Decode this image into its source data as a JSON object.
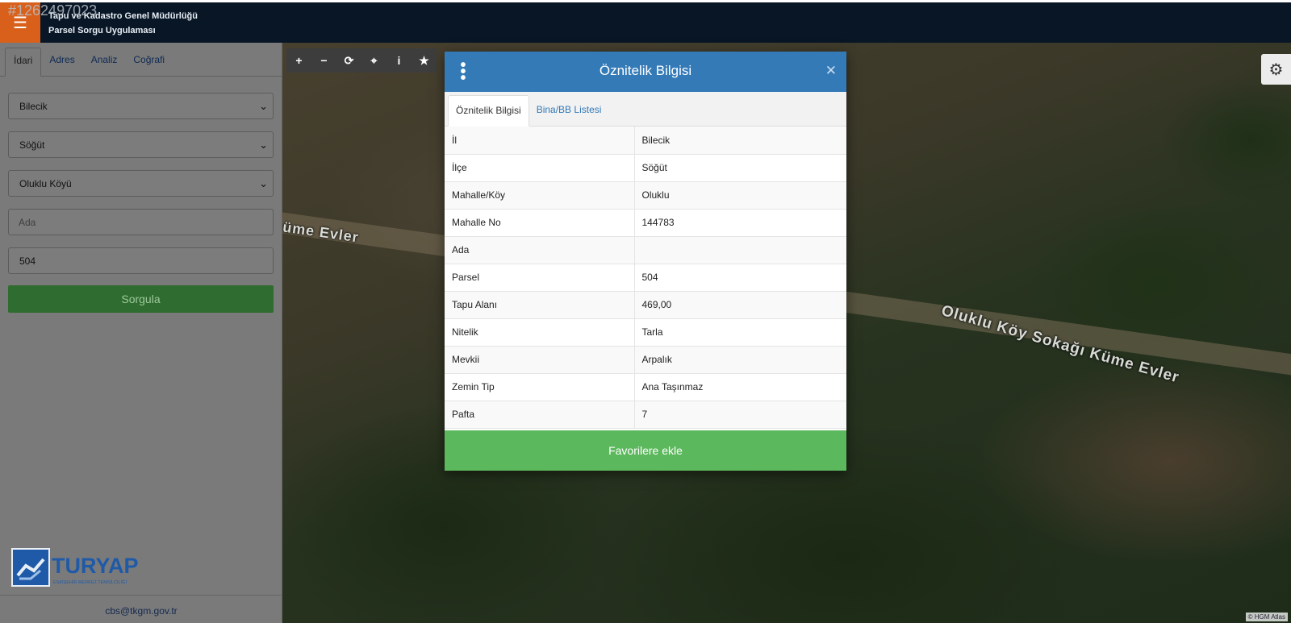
{
  "header": {
    "watermark_id": "#1262497023",
    "title_line1": "Tapu ve Kadastro Genel Müdürlüğü",
    "title_line2": "Parsel Sorgu Uygulaması",
    "menu_icon": "hamburger-icon",
    "accent_color": "#d9601a",
    "bar_color": "#081626"
  },
  "sidebar": {
    "tabs": [
      {
        "label": "İdari",
        "active": true
      },
      {
        "label": "Adres"
      },
      {
        "label": "Analiz"
      },
      {
        "label": "Coğrafi"
      }
    ],
    "il": "Bilecik",
    "ilce": "Söğüt",
    "mahalle": "Oluklu Köyü",
    "ada_placeholder": "Ada",
    "parsel_value": "504",
    "submit_label": "Sorgula",
    "logo_text": "TURYAP",
    "logo_subtext": "ESKİŞEHİR MERKEZ TEMSİLCİLİĞİ",
    "footer_email": "cbs@tkgm.gov.tr"
  },
  "map": {
    "road_label_1": "üme Evler",
    "road_label_2": "Oluklu Köy Sokağı Küme Evler",
    "credit": "© HGM Atlas",
    "toolbar_icons": [
      "zoom-in-icon",
      "zoom-out-icon",
      "refresh-icon",
      "locate-icon",
      "info-icon",
      "star-icon"
    ],
    "settings_icon": "gear-icon"
  },
  "modal": {
    "title": "Öznitelik Bilgisi",
    "tabs": [
      {
        "label": "Öznitelik Bilgisi",
        "active": true
      },
      {
        "label": "Bina/BB Listesi"
      }
    ],
    "rows": [
      {
        "key": "İl",
        "value": "Bilecik"
      },
      {
        "key": "İlçe",
        "value": "Söğüt"
      },
      {
        "key": "Mahalle/Köy",
        "value": "Oluklu"
      },
      {
        "key": "Mahalle No",
        "value": "144783"
      },
      {
        "key": "Ada",
        "value": ""
      },
      {
        "key": "Parsel",
        "value": "504"
      },
      {
        "key": "Tapu Alanı",
        "value": "469,00"
      },
      {
        "key": "Nitelik",
        "value": "Tarla"
      },
      {
        "key": "Mevkii",
        "value": "Arpalık"
      },
      {
        "key": "Zemin Tip",
        "value": "Ana Taşınmaz"
      },
      {
        "key": "Pafta",
        "value": "7"
      }
    ],
    "favorite_label": "Favorilere ekle",
    "header_color": "#337ab7",
    "button_color": "#5cb85c"
  }
}
